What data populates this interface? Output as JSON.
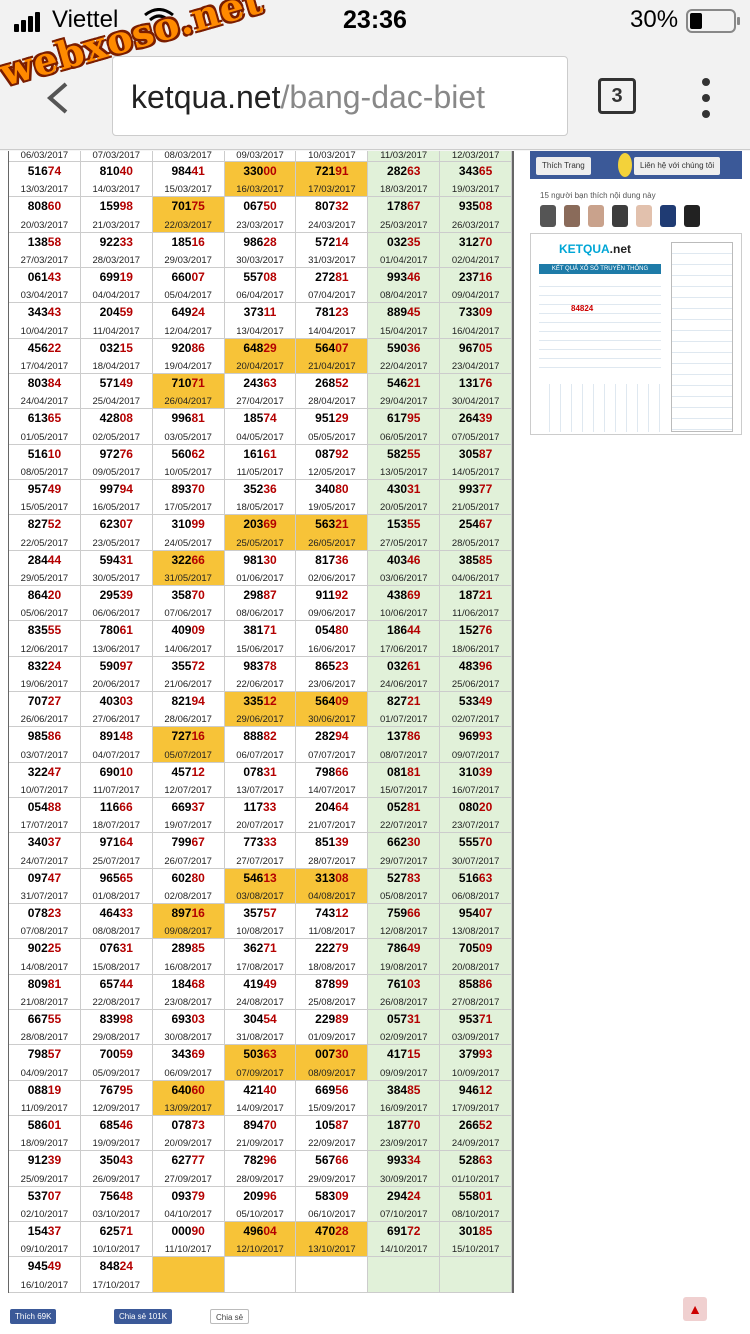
{
  "status_bar": {
    "carrier": "Viettel",
    "time": "23:36",
    "battery": "30%"
  },
  "browser": {
    "url_domain": "ketqua.net",
    "url_path": "/bang-dac-biet",
    "tab_count": "3"
  },
  "watermark": "webxoso.net",
  "colors": {
    "sunday_bg": "#e1f1d9",
    "highlight_bg": "#f7c338",
    "number_accent": "#b40000"
  },
  "table": {
    "rows": [
      [
        {
          "d": "06/03/2017"
        },
        {
          "d": "07/03/2017"
        },
        {
          "d": "08/03/2017"
        },
        {
          "d": "09/03/2017"
        },
        {
          "d": "10/03/2017"
        },
        {
          "d": "11/03/2017"
        },
        {
          "d": "12/03/2017"
        }
      ],
      [
        {
          "n": "51674",
          "d": "13/03/2017"
        },
        {
          "n": "81040",
          "d": "14/03/2017"
        },
        {
          "n": "98441",
          "d": "15/03/2017"
        },
        {
          "n": "33000",
          "d": "16/03/2017",
          "h": 1
        },
        {
          "n": "72191",
          "d": "17/03/2017",
          "h": 1
        },
        {
          "n": "28263",
          "d": "18/03/2017"
        },
        {
          "n": "34365",
          "d": "19/03/2017"
        }
      ],
      [
        {
          "n": "80860",
          "d": "20/03/2017"
        },
        {
          "n": "15998",
          "d": "21/03/2017"
        },
        {
          "n": "70175",
          "d": "22/03/2017",
          "h": 1
        },
        {
          "n": "06750",
          "d": "23/03/2017"
        },
        {
          "n": "80732",
          "d": "24/03/2017"
        },
        {
          "n": "17867",
          "d": "25/03/2017"
        },
        {
          "n": "93508",
          "d": "26/03/2017"
        }
      ],
      [
        {
          "n": "13858",
          "d": "27/03/2017"
        },
        {
          "n": "92233",
          "d": "28/03/2017"
        },
        {
          "n": "18516",
          "d": "29/03/2017"
        },
        {
          "n": "98628",
          "d": "30/03/2017"
        },
        {
          "n": "57214",
          "d": "31/03/2017"
        },
        {
          "n": "03235",
          "d": "01/04/2017"
        },
        {
          "n": "31270",
          "d": "02/04/2017"
        }
      ],
      [
        {
          "n": "06143",
          "d": "03/04/2017"
        },
        {
          "n": "69919",
          "d": "04/04/2017"
        },
        {
          "n": "66007",
          "d": "05/04/2017"
        },
        {
          "n": "55708",
          "d": "06/04/2017"
        },
        {
          "n": "27281",
          "d": "07/04/2017"
        },
        {
          "n": "99346",
          "d": "08/04/2017"
        },
        {
          "n": "23716",
          "d": "09/04/2017"
        }
      ],
      [
        {
          "n": "34343",
          "d": "10/04/2017"
        },
        {
          "n": "20459",
          "d": "11/04/2017"
        },
        {
          "n": "64924",
          "d": "12/04/2017"
        },
        {
          "n": "37311",
          "d": "13/04/2017"
        },
        {
          "n": "78123",
          "d": "14/04/2017"
        },
        {
          "n": "88945",
          "d": "15/04/2017"
        },
        {
          "n": "73309",
          "d": "16/04/2017"
        }
      ],
      [
        {
          "n": "45622",
          "d": "17/04/2017"
        },
        {
          "n": "03215",
          "d": "18/04/2017"
        },
        {
          "n": "92086",
          "d": "19/04/2017"
        },
        {
          "n": "64829",
          "d": "20/04/2017",
          "h": 1
        },
        {
          "n": "56407",
          "d": "21/04/2017",
          "h": 1
        },
        {
          "n": "59036",
          "d": "22/04/2017"
        },
        {
          "n": "96705",
          "d": "23/04/2017"
        }
      ],
      [
        {
          "n": "80384",
          "d": "24/04/2017"
        },
        {
          "n": "57149",
          "d": "25/04/2017"
        },
        {
          "n": "71071",
          "d": "26/04/2017",
          "h": 1
        },
        {
          "n": "24363",
          "d": "27/04/2017"
        },
        {
          "n": "26852",
          "d": "28/04/2017"
        },
        {
          "n": "54621",
          "d": "29/04/2017"
        },
        {
          "n": "13176",
          "d": "30/04/2017"
        }
      ],
      [
        {
          "n": "61365",
          "d": "01/05/2017"
        },
        {
          "n": "42808",
          "d": "02/05/2017"
        },
        {
          "n": "99681",
          "d": "03/05/2017"
        },
        {
          "n": "18574",
          "d": "04/05/2017"
        },
        {
          "n": "95129",
          "d": "05/05/2017"
        },
        {
          "n": "61795",
          "d": "06/05/2017"
        },
        {
          "n": "26439",
          "d": "07/05/2017"
        }
      ],
      [
        {
          "n": "51610",
          "d": "08/05/2017"
        },
        {
          "n": "97276",
          "d": "09/05/2017"
        },
        {
          "n": "56062",
          "d": "10/05/2017"
        },
        {
          "n": "16161",
          "d": "11/05/2017"
        },
        {
          "n": "08792",
          "d": "12/05/2017"
        },
        {
          "n": "58255",
          "d": "13/05/2017"
        },
        {
          "n": "30587",
          "d": "14/05/2017"
        }
      ],
      [
        {
          "n": "95749",
          "d": "15/05/2017"
        },
        {
          "n": "99794",
          "d": "16/05/2017"
        },
        {
          "n": "89370",
          "d": "17/05/2017"
        },
        {
          "n": "35236",
          "d": "18/05/2017"
        },
        {
          "n": "34080",
          "d": "19/05/2017"
        },
        {
          "n": "43031",
          "d": "20/05/2017"
        },
        {
          "n": "99377",
          "d": "21/05/2017"
        }
      ],
      [
        {
          "n": "82752",
          "d": "22/05/2017"
        },
        {
          "n": "62307",
          "d": "23/05/2017"
        },
        {
          "n": "31099",
          "d": "24/05/2017"
        },
        {
          "n": "20369",
          "d": "25/05/2017",
          "h": 1
        },
        {
          "n": "56321",
          "d": "26/05/2017",
          "h": 1
        },
        {
          "n": "15355",
          "d": "27/05/2017"
        },
        {
          "n": "25467",
          "d": "28/05/2017"
        }
      ],
      [
        {
          "n": "28444",
          "d": "29/05/2017"
        },
        {
          "n": "59431",
          "d": "30/05/2017"
        },
        {
          "n": "32266",
          "d": "31/05/2017",
          "h": 1
        },
        {
          "n": "98130",
          "d": "01/06/2017"
        },
        {
          "n": "81736",
          "d": "02/06/2017"
        },
        {
          "n": "40346",
          "d": "03/06/2017"
        },
        {
          "n": "38585",
          "d": "04/06/2017"
        }
      ],
      [
        {
          "n": "86420",
          "d": "05/06/2017"
        },
        {
          "n": "29539",
          "d": "06/06/2017"
        },
        {
          "n": "35870",
          "d": "07/06/2017"
        },
        {
          "n": "29887",
          "d": "08/06/2017"
        },
        {
          "n": "91192",
          "d": "09/06/2017"
        },
        {
          "n": "43869",
          "d": "10/06/2017"
        },
        {
          "n": "18721",
          "d": "11/06/2017"
        }
      ],
      [
        {
          "n": "83555",
          "d": "12/06/2017"
        },
        {
          "n": "78061",
          "d": "13/06/2017"
        },
        {
          "n": "40909",
          "d": "14/06/2017"
        },
        {
          "n": "38171",
          "d": "15/06/2017"
        },
        {
          "n": "05480",
          "d": "16/06/2017"
        },
        {
          "n": "18644",
          "d": "17/06/2017"
        },
        {
          "n": "15276",
          "d": "18/06/2017"
        }
      ],
      [
        {
          "n": "83224",
          "d": "19/06/2017"
        },
        {
          "n": "59097",
          "d": "20/06/2017"
        },
        {
          "n": "35572",
          "d": "21/06/2017"
        },
        {
          "n": "98378",
          "d": "22/06/2017"
        },
        {
          "n": "86523",
          "d": "23/06/2017"
        },
        {
          "n": "03261",
          "d": "24/06/2017"
        },
        {
          "n": "48396",
          "d": "25/06/2017"
        }
      ],
      [
        {
          "n": "70727",
          "d": "26/06/2017"
        },
        {
          "n": "40303",
          "d": "27/06/2017"
        },
        {
          "n": "82194",
          "d": "28/06/2017"
        },
        {
          "n": "33512",
          "d": "29/06/2017",
          "h": 1
        },
        {
          "n": "56409",
          "d": "30/06/2017",
          "h": 1
        },
        {
          "n": "82721",
          "d": "01/07/2017"
        },
        {
          "n": "53349",
          "d": "02/07/2017"
        }
      ],
      [
        {
          "n": "98586",
          "d": "03/07/2017"
        },
        {
          "n": "89148",
          "d": "04/07/2017"
        },
        {
          "n": "72716",
          "d": "05/07/2017",
          "h": 1
        },
        {
          "n": "88882",
          "d": "06/07/2017"
        },
        {
          "n": "28294",
          "d": "07/07/2017"
        },
        {
          "n": "13786",
          "d": "08/07/2017"
        },
        {
          "n": "96993",
          "d": "09/07/2017"
        }
      ],
      [
        {
          "n": "32247",
          "d": "10/07/2017"
        },
        {
          "n": "69010",
          "d": "11/07/2017"
        },
        {
          "n": "45712",
          "d": "12/07/2017"
        },
        {
          "n": "07831",
          "d": "13/07/2017"
        },
        {
          "n": "79866",
          "d": "14/07/2017"
        },
        {
          "n": "08181",
          "d": "15/07/2017"
        },
        {
          "n": "31039",
          "d": "16/07/2017"
        }
      ],
      [
        {
          "n": "05488",
          "d": "17/07/2017"
        },
        {
          "n": "11666",
          "d": "18/07/2017"
        },
        {
          "n": "66937",
          "d": "19/07/2017"
        },
        {
          "n": "11733",
          "d": "20/07/2017"
        },
        {
          "n": "20464",
          "d": "21/07/2017"
        },
        {
          "n": "05281",
          "d": "22/07/2017"
        },
        {
          "n": "08020",
          "d": "23/07/2017"
        }
      ],
      [
        {
          "n": "34037",
          "d": "24/07/2017"
        },
        {
          "n": "97164",
          "d": "25/07/2017"
        },
        {
          "n": "79967",
          "d": "26/07/2017"
        },
        {
          "n": "77333",
          "d": "27/07/2017"
        },
        {
          "n": "85139",
          "d": "28/07/2017"
        },
        {
          "n": "66230",
          "d": "29/07/2017"
        },
        {
          "n": "55570",
          "d": "30/07/2017"
        }
      ],
      [
        {
          "n": "09747",
          "d": "31/07/2017"
        },
        {
          "n": "96565",
          "d": "01/08/2017"
        },
        {
          "n": "60280",
          "d": "02/08/2017"
        },
        {
          "n": "54613",
          "d": "03/08/2017",
          "h": 1
        },
        {
          "n": "31308",
          "d": "04/08/2017",
          "h": 1
        },
        {
          "n": "52783",
          "d": "05/08/2017"
        },
        {
          "n": "51663",
          "d": "06/08/2017"
        }
      ],
      [
        {
          "n": "07823",
          "d": "07/08/2017"
        },
        {
          "n": "46433",
          "d": "08/08/2017"
        },
        {
          "n": "89716",
          "d": "09/08/2017",
          "h": 1
        },
        {
          "n": "35757",
          "d": "10/08/2017"
        },
        {
          "n": "74312",
          "d": "11/08/2017"
        },
        {
          "n": "75966",
          "d": "12/08/2017"
        },
        {
          "n": "95407",
          "d": "13/08/2017"
        }
      ],
      [
        {
          "n": "90225",
          "d": "14/08/2017"
        },
        {
          "n": "07631",
          "d": "15/08/2017"
        },
        {
          "n": "28985",
          "d": "16/08/2017"
        },
        {
          "n": "36271",
          "d": "17/08/2017"
        },
        {
          "n": "22279",
          "d": "18/08/2017"
        },
        {
          "n": "78649",
          "d": "19/08/2017"
        },
        {
          "n": "70509",
          "d": "20/08/2017"
        }
      ],
      [
        {
          "n": "80981",
          "d": "21/08/2017"
        },
        {
          "n": "65744",
          "d": "22/08/2017"
        },
        {
          "n": "18468",
          "d": "23/08/2017"
        },
        {
          "n": "41949",
          "d": "24/08/2017"
        },
        {
          "n": "87899",
          "d": "25/08/2017"
        },
        {
          "n": "76103",
          "d": "26/08/2017"
        },
        {
          "n": "85886",
          "d": "27/08/2017"
        }
      ],
      [
        {
          "n": "66755",
          "d": "28/08/2017"
        },
        {
          "n": "83998",
          "d": "29/08/2017"
        },
        {
          "n": "69303",
          "d": "30/08/2017"
        },
        {
          "n": "30454",
          "d": "31/08/2017"
        },
        {
          "n": "22989",
          "d": "01/09/2017"
        },
        {
          "n": "05731",
          "d": "02/09/2017"
        },
        {
          "n": "95371",
          "d": "03/09/2017"
        }
      ],
      [
        {
          "n": "79857",
          "d": "04/09/2017"
        },
        {
          "n": "70059",
          "d": "05/09/2017"
        },
        {
          "n": "34369",
          "d": "06/09/2017"
        },
        {
          "n": "50363",
          "d": "07/09/2017",
          "h": 1
        },
        {
          "n": "00730",
          "d": "08/09/2017",
          "h": 1
        },
        {
          "n": "41715",
          "d": "09/09/2017"
        },
        {
          "n": "37993",
          "d": "10/09/2017"
        }
      ],
      [
        {
          "n": "08819",
          "d": "11/09/2017"
        },
        {
          "n": "76795",
          "d": "12/09/2017"
        },
        {
          "n": "64060",
          "d": "13/09/2017",
          "h": 1
        },
        {
          "n": "42140",
          "d": "14/09/2017"
        },
        {
          "n": "66956",
          "d": "15/09/2017"
        },
        {
          "n": "38485",
          "d": "16/09/2017"
        },
        {
          "n": "94612",
          "d": "17/09/2017"
        }
      ],
      [
        {
          "n": "58601",
          "d": "18/09/2017"
        },
        {
          "n": "68546",
          "d": "19/09/2017"
        },
        {
          "n": "07873",
          "d": "20/09/2017"
        },
        {
          "n": "89470",
          "d": "21/09/2017"
        },
        {
          "n": "10587",
          "d": "22/09/2017"
        },
        {
          "n": "18770",
          "d": "23/09/2017"
        },
        {
          "n": "26652",
          "d": "24/09/2017"
        }
      ],
      [
        {
          "n": "91239",
          "d": "25/09/2017"
        },
        {
          "n": "35043",
          "d": "26/09/2017"
        },
        {
          "n": "62777",
          "d": "27/09/2017"
        },
        {
          "n": "78296",
          "d": "28/09/2017"
        },
        {
          "n": "56766",
          "d": "29/09/2017"
        },
        {
          "n": "99334",
          "d": "30/09/2017"
        },
        {
          "n": "52863",
          "d": "01/10/2017"
        }
      ],
      [
        {
          "n": "53707",
          "d": "02/10/2017"
        },
        {
          "n": "75648",
          "d": "03/10/2017"
        },
        {
          "n": "09379",
          "d": "04/10/2017"
        },
        {
          "n": "20996",
          "d": "05/10/2017"
        },
        {
          "n": "58309",
          "d": "06/10/2017"
        },
        {
          "n": "29424",
          "d": "07/10/2017"
        },
        {
          "n": "55801",
          "d": "08/10/2017"
        }
      ],
      [
        {
          "n": "15437",
          "d": "09/10/2017"
        },
        {
          "n": "62571",
          "d": "10/10/2017"
        },
        {
          "n": "00090",
          "d": "11/10/2017"
        },
        {
          "n": "49604",
          "d": "12/10/2017",
          "h": 1
        },
        {
          "n": "47028",
          "d": "13/10/2017",
          "h": 1
        },
        {
          "n": "69172",
          "d": "14/10/2017"
        },
        {
          "n": "30185",
          "d": "15/10/2017"
        }
      ],
      [
        {
          "n": "94549",
          "d": "16/10/2017"
        },
        {
          "n": "84824",
          "d": "17/10/2017"
        },
        {
          "h": 1
        },
        {},
        {},
        {},
        {}
      ]
    ]
  },
  "social": {
    "like": "Thích 69K",
    "share": "Chia sẻ 101K",
    "gplus": "Chia sẻ"
  },
  "sidebar": {
    "fb_like": "Thích Trang",
    "fb_contact": "Liên hệ với chúng tôi",
    "friends_text": "15 người bạn thích nội dung này",
    "ad_logo_a": "KETQUA",
    "ad_logo_b": ".net",
    "ad_header": "KẾT QUẢ XỔ SỐ TRUYỀN THỐNG",
    "ad_number": "84824"
  },
  "icons": {
    "back": "back-arrow-icon",
    "wifi": "wifi-icon",
    "menu": "more-vert-icon",
    "scroll_top": "chevron-up-icon"
  }
}
